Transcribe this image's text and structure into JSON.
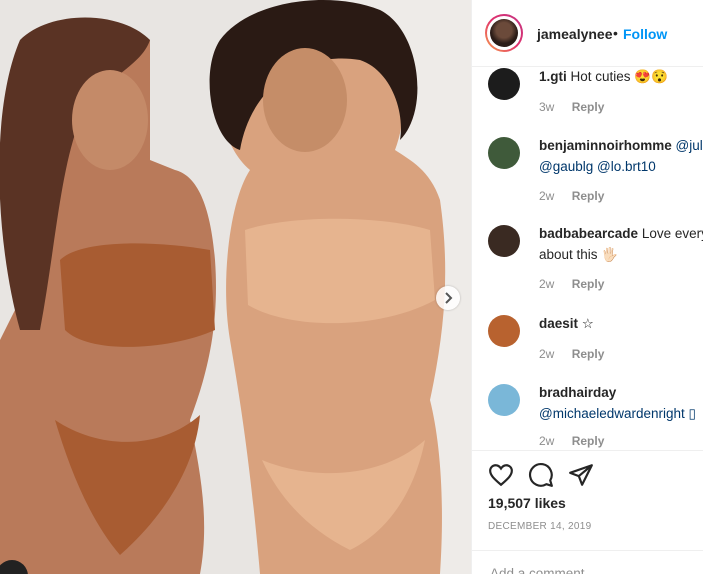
{
  "post": {
    "media_alt": "Photo",
    "next_icon": "chevron-right-icon"
  },
  "header": {
    "username": "jamealynee",
    "separator": "•",
    "follow_label": "Follow"
  },
  "comments": [
    {
      "username": "1.gti",
      "text": "Hot cuties 😍😯",
      "time": "3w",
      "reply": "Reply",
      "avatar_color": "#1c1c1c"
    },
    {
      "username": "benjaminnoirhomme",
      "mention1": "@jul",
      "line2": "@gaublg @lo.brt10",
      "time": "2w",
      "reply": "Reply",
      "avatar_color": "#3f5a3a"
    },
    {
      "username": "badbabearcade",
      "text": "Love every",
      "line2": "about this 🖐🏻",
      "time": "2w",
      "reply": "Reply",
      "avatar_color": "#3a2a22"
    },
    {
      "username": "daesit",
      "text": "☆",
      "time": "2w",
      "reply": "Reply",
      "avatar_color": "#b8622f"
    },
    {
      "username": "bradhairday",
      "line2": "@michaeledwardenright ▯",
      "time": "2w",
      "reply": "Reply",
      "avatar_color": "#7ab7d8"
    }
  ],
  "actions": {
    "like_icon": "heart-icon",
    "comment_icon": "comment-icon",
    "share_icon": "share-icon",
    "likes": "19,507 likes",
    "date": "DECEMBER 14, 2019",
    "comment_placeholder": "Add a comment..."
  }
}
